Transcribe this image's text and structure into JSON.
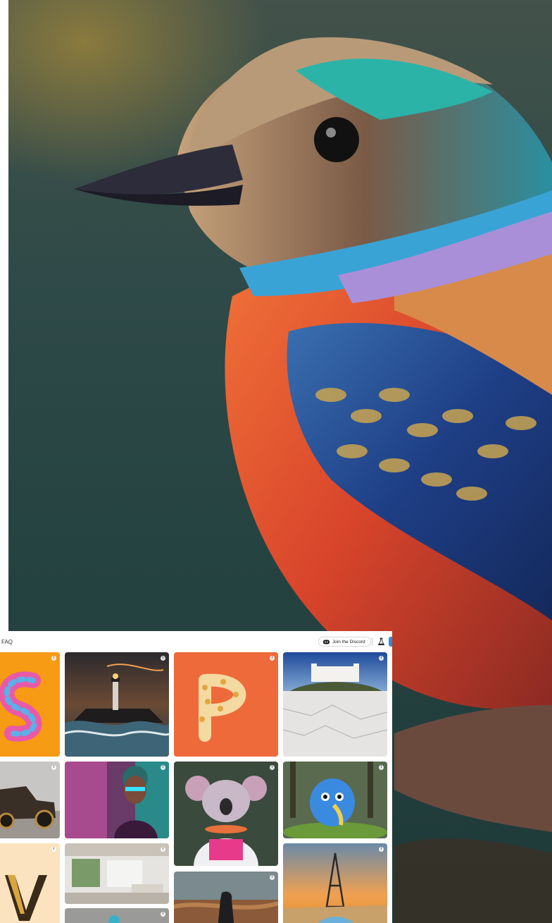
{
  "topbar": {
    "faq_label": "FAQ",
    "discord_label": "Join the Discord"
  },
  "icons": {
    "info": "i",
    "discord": "discord-icon",
    "lab": "flask-icon"
  },
  "colors": {
    "accent": "#2f8bd6",
    "tile_orange": "#f79a14",
    "tile_coral": "#ee6a3a",
    "tile_cream": "#fbe3bf"
  }
}
